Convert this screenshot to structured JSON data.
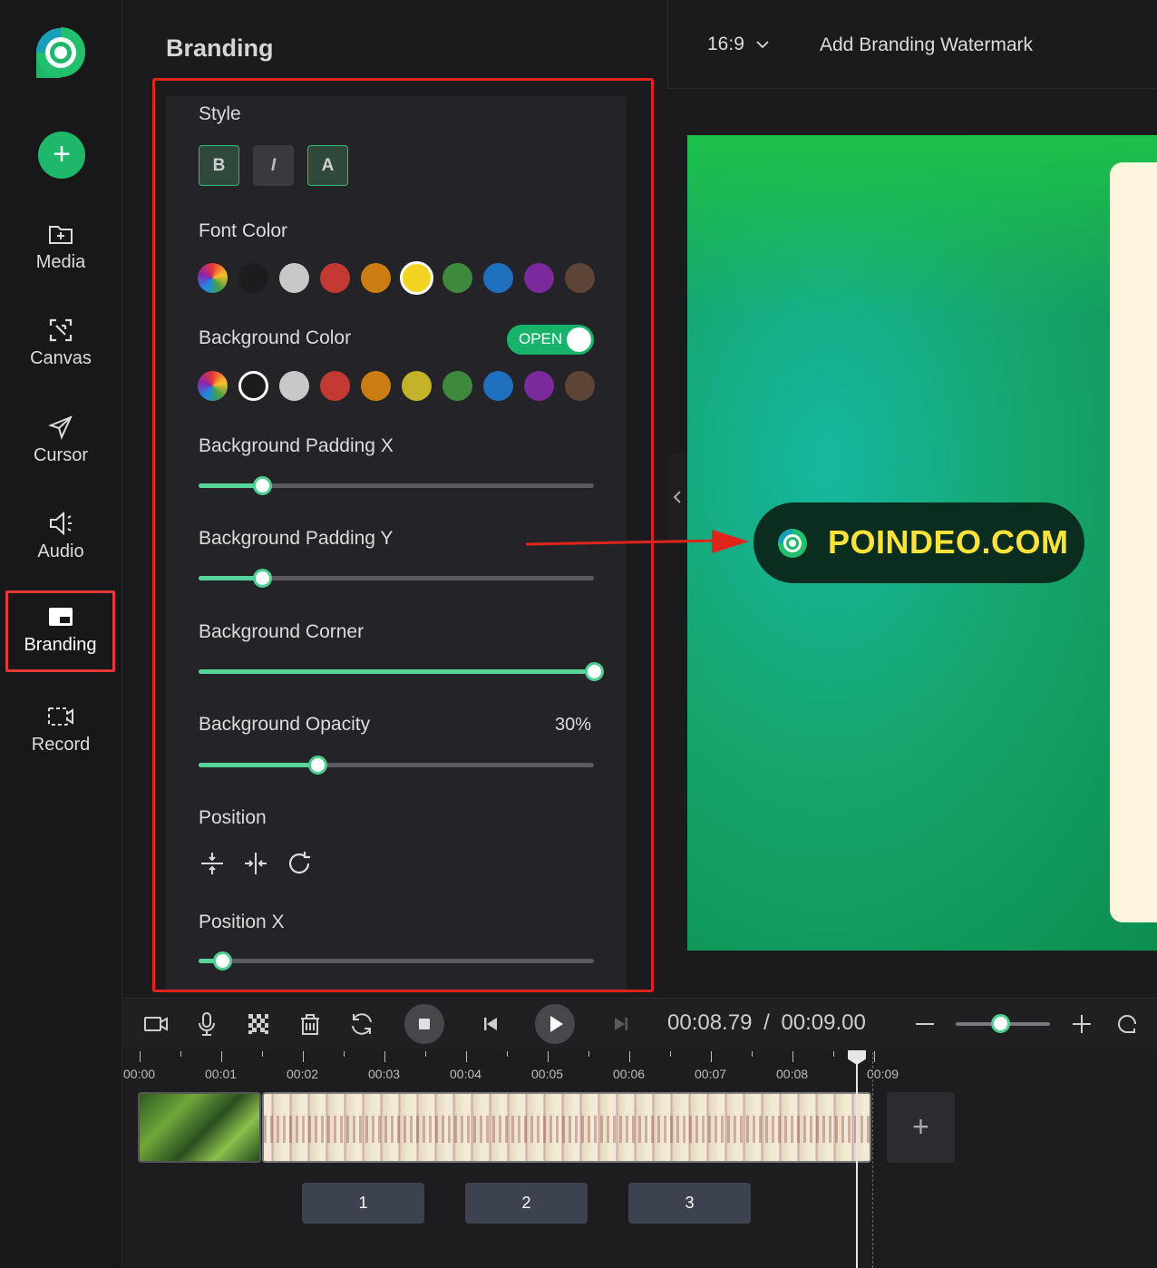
{
  "nav": {
    "items": [
      {
        "label": "Media",
        "icon": "folder-plus-icon"
      },
      {
        "label": "Canvas",
        "icon": "canvas-icon"
      },
      {
        "label": "Cursor",
        "icon": "cursor-icon"
      },
      {
        "label": "Audio",
        "icon": "speaker-icon"
      },
      {
        "label": "Branding",
        "icon": "branding-icon"
      },
      {
        "label": "Record",
        "icon": "record-icon"
      }
    ],
    "active": "Branding",
    "add_label": "+"
  },
  "panel": {
    "title": "Branding",
    "style_label": "Style",
    "style_buttons": [
      "B",
      "I",
      "A"
    ],
    "font_color_label": "Font Color",
    "font_colors": [
      "multicolor",
      "#1c1c1e",
      "#c8c8c8",
      "#c23a32",
      "#cc7d12",
      "#f2d321",
      "#3d8a3e",
      "#1f6fbf",
      "#7a2a9c",
      "#5e4337"
    ],
    "font_color_selected": "#f2d321",
    "bg_color_label": "Background Color",
    "bg_toggle_label": "OPEN",
    "bg_colors": [
      "multicolor",
      "#1c1c1e",
      "#c8c8c8",
      "#c23a32",
      "#cc7d12",
      "#c4b32a",
      "#3d8a3e",
      "#1f6fbf",
      "#7a2a9c",
      "#5e4337"
    ],
    "bg_color_selected": "#1c1c1e",
    "padding_x_label": "Background Padding X",
    "padding_x_value": 0.16,
    "padding_y_label": "Background Padding Y",
    "padding_y_value": 0.16,
    "corner_label": "Background Corner",
    "corner_value": 1.0,
    "opacity_label": "Background Opacity",
    "opacity_display": "30%",
    "opacity_value": 0.3,
    "position_label": "Position",
    "position_icons": [
      "align-vertical-center-icon",
      "align-horizontal-center-icon",
      "reset-icon"
    ],
    "position_x_label": "Position X",
    "position_x_value": 0.06
  },
  "topbar": {
    "ratio": "16:9",
    "title": "Add Branding Watermark"
  },
  "preview": {
    "watermark_text": "POINDEO.COM",
    "watermark_text_color": "#ffe33a"
  },
  "toolbar": {
    "icons": [
      "camera-icon",
      "microphone-icon",
      "mosaic-icon",
      "delete-icon",
      "rotate-icon"
    ],
    "current_time": "00:08.79",
    "separator": "/",
    "total_time": "00:09.00",
    "zoom_value": 0.47
  },
  "timeline": {
    "ticks": [
      "00:00",
      "00:01",
      "00:02",
      "00:03",
      "00:04",
      "00:05",
      "00:06",
      "00:07",
      "00:08",
      "00:09"
    ],
    "add_label": "+",
    "pages": [
      "1",
      "2",
      "3"
    ]
  },
  "accent": "#1fb86a"
}
